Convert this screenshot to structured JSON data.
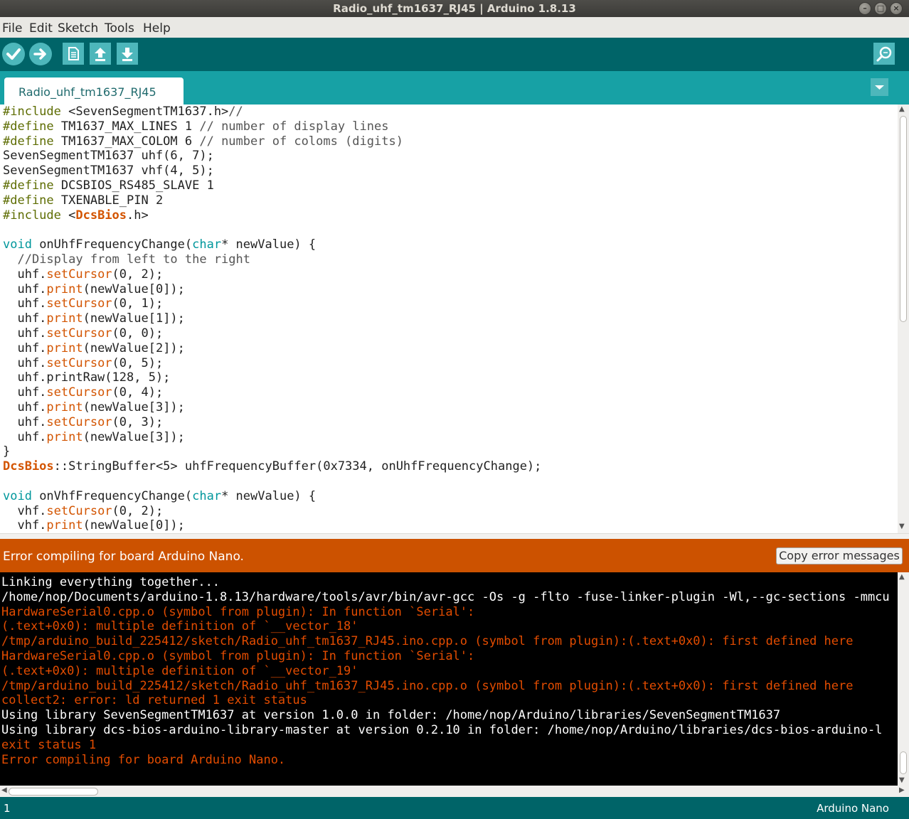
{
  "window": {
    "title": "Radio_uhf_tm1637_RJ45 | Arduino 1.8.13"
  },
  "menubar": {
    "items": [
      "File",
      "Edit",
      "Sketch",
      "Tools",
      "Help"
    ]
  },
  "toolbar": {
    "buttons": [
      "verify-icon",
      "upload-icon",
      "new-icon",
      "open-icon",
      "save-icon",
      "serial-monitor-icon"
    ],
    "accent": "#006468",
    "button_color": "#4db7bb"
  },
  "tabs": {
    "active": "Radio_uhf_tm1637_RJ45"
  },
  "editor": {
    "lines": [
      "#include <SevenSegmentTM1637.h>//",
      "#define TM1637_MAX_LINES 1 // number of display lines",
      "#define TM1637_MAX_COLOM 6 // number of coloms (digits)",
      "SevenSegmentTM1637 uhf(6, 7);",
      "SevenSegmentTM1637 vhf(4, 5);",
      "#define DCSBIOS_RS485_SLAVE 1",
      "#define TXENABLE_PIN 2",
      "#include <DcsBios.h>",
      "",
      "void onUhfFrequencyChange(char* newValue) {",
      "  //Display from left to the right",
      "  uhf.setCursor(0, 2);",
      "  uhf.print(newValue[0]);",
      "  uhf.setCursor(0, 1);",
      "  uhf.print(newValue[1]);",
      "  uhf.setCursor(0, 0);",
      "  uhf.print(newValue[2]);",
      "  uhf.setCursor(0, 5);",
      "  uhf.printRaw(128, 5);",
      "  uhf.setCursor(0, 4);",
      "  uhf.print(newValue[3]);",
      "  uhf.setCursor(0, 3);",
      "  uhf.print(newValue[3]);",
      "}",
      "DcsBios::StringBuffer<5> uhfFrequencyBuffer(0x7334, onUhfFrequencyChange);",
      "",
      "void onVhfFrequencyChange(char* newValue) {",
      "  vhf.setCursor(0, 2);",
      "  vhf.print(newValue[0]);"
    ]
  },
  "status": {
    "message": "Error compiling for board Arduino Nano.",
    "copy_button": "Copy error messages",
    "color": "#cc5200"
  },
  "console": {
    "lines": [
      {
        "text": "Linking everything together...",
        "type": "info"
      },
      {
        "text": "/home/nop/Documents/arduino-1.8.13/hardware/tools/avr/bin/avr-gcc -Os -g -flto -fuse-linker-plugin -Wl,--gc-sections -mmcu",
        "type": "info"
      },
      {
        "text": "HardwareSerial0.cpp.o (symbol from plugin): In function `Serial':",
        "type": "error"
      },
      {
        "text": "(.text+0x0): multiple definition of `__vector_18'",
        "type": "error"
      },
      {
        "text": "/tmp/arduino_build_225412/sketch/Radio_uhf_tm1637_RJ45.ino.cpp.o (symbol from plugin):(.text+0x0): first defined here",
        "type": "error"
      },
      {
        "text": "HardwareSerial0.cpp.o (symbol from plugin): In function `Serial':",
        "type": "error"
      },
      {
        "text": "(.text+0x0): multiple definition of `__vector_19'",
        "type": "error"
      },
      {
        "text": "/tmp/arduino_build_225412/sketch/Radio_uhf_tm1637_RJ45.ino.cpp.o (symbol from plugin):(.text+0x0): first defined here",
        "type": "error"
      },
      {
        "text": "collect2: error: ld returned 1 exit status",
        "type": "error"
      },
      {
        "text": "Using library SevenSegmentTM1637 at version 1.0.0 in folder: /home/nop/Arduino/libraries/SevenSegmentTM1637",
        "type": "info"
      },
      {
        "text": "Using library dcs-bios-arduino-library-master at version 0.2.10 in folder: /home/nop/Arduino/libraries/dcs-bios-arduino-l",
        "type": "info"
      },
      {
        "text": "exit status 1",
        "type": "error"
      },
      {
        "text": "Error compiling for board Arduino Nano.",
        "type": "error"
      }
    ]
  },
  "bottom": {
    "line_number": "1",
    "board": "Arduino Nano"
  }
}
